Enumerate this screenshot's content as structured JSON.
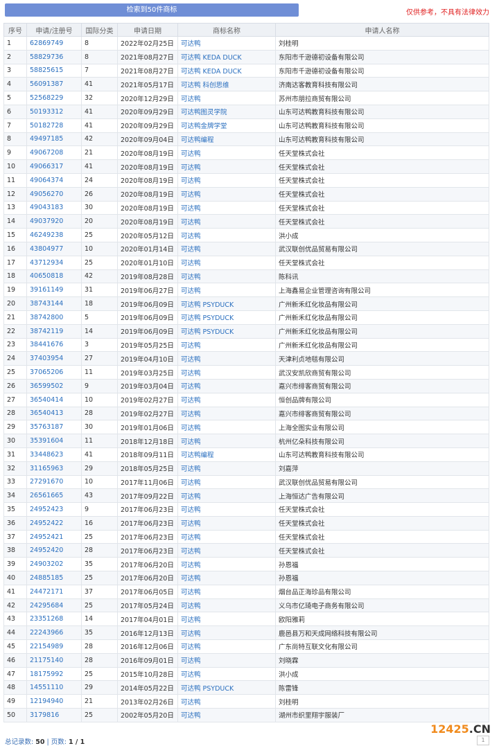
{
  "header": {
    "banner": "检索到50件商标",
    "disclaimer": "仅供参考，不具有法律效力"
  },
  "table": {
    "columns": [
      "序号",
      "申请/注册号",
      "国际分类",
      "申请日期",
      "商标名称",
      "申请人名称"
    ],
    "rows": [
      [
        "1",
        "62869749",
        "8",
        "2022年02月25日",
        "可达鸭",
        "刘桂明"
      ],
      [
        "2",
        "58829736",
        "8",
        "2021年08月27日",
        "可达鸭 KEDA DUCK",
        "东阳市千逊德初设备有限公司"
      ],
      [
        "3",
        "58825615",
        "7",
        "2021年08月27日",
        "可达鸭 KEDA DUCK",
        "东阳市千逊德初设备有限公司"
      ],
      [
        "4",
        "56091387",
        "41",
        "2021年05月17日",
        "可达鸭 科创思维",
        "济南达客教育科技有限公司"
      ],
      [
        "5",
        "52568229",
        "32",
        "2020年12月29日",
        "可达鸭",
        "苏州市朋拉商贸有限公司"
      ],
      [
        "6",
        "50193312",
        "41",
        "2020年09月29日",
        "可达鸭图灵学院",
        "山东可达鸭教育科技有限公司"
      ],
      [
        "7",
        "50182728",
        "41",
        "2020年09月29日",
        "可达鸭金牌学堂",
        "山东可达鸭教育科技有限公司"
      ],
      [
        "8",
        "49497185",
        "42",
        "2020年09月04日",
        "可达鸭编程",
        "山东可达鸭教育科技有限公司"
      ],
      [
        "9",
        "49067208",
        "21",
        "2020年08月19日",
        "可达鸭",
        "任天堂株式会社"
      ],
      [
        "10",
        "49066317",
        "41",
        "2020年08月19日",
        "可达鸭",
        "任天堂株式会社"
      ],
      [
        "11",
        "49064374",
        "24",
        "2020年08月19日",
        "可达鸭",
        "任天堂株式会社"
      ],
      [
        "12",
        "49056270",
        "26",
        "2020年08月19日",
        "可达鸭",
        "任天堂株式会社"
      ],
      [
        "13",
        "49043183",
        "30",
        "2020年08月19日",
        "可达鸭",
        "任天堂株式会社"
      ],
      [
        "14",
        "49037920",
        "20",
        "2020年08月19日",
        "可达鸭",
        "任天堂株式会社"
      ],
      [
        "15",
        "46249238",
        "25",
        "2020年05月12日",
        "可达鸭",
        "洪小成"
      ],
      [
        "16",
        "43804977",
        "10",
        "2020年01月14日",
        "可达鸭",
        "武汉联创优品贸易有限公司"
      ],
      [
        "17",
        "43712934",
        "25",
        "2020年01月10日",
        "可达鸭",
        "任天堂株式会社"
      ],
      [
        "18",
        "40650818",
        "42",
        "2019年08月28日",
        "可达鸭",
        "陈科讯"
      ],
      [
        "19",
        "39161149",
        "31",
        "2019年06月27日",
        "可达鸭",
        "上海鑫易企业管理咨询有限公司"
      ],
      [
        "20",
        "38743144",
        "18",
        "2019年06月09日",
        "可达鸭 PSYDUCK",
        "广州新禾红化妆品有限公司"
      ],
      [
        "21",
        "38742800",
        "5",
        "2019年06月09日",
        "可达鸭 PSYDUCK",
        "广州新禾红化妆品有限公司"
      ],
      [
        "22",
        "38742119",
        "14",
        "2019年06月09日",
        "可达鸭 PSYDUCK",
        "广州新禾红化妆品有限公司"
      ],
      [
        "23",
        "38441676",
        "3",
        "2019年05月25日",
        "可达鸭",
        "广州新禾红化妆品有限公司"
      ],
      [
        "24",
        "37403954",
        "27",
        "2019年04月10日",
        "可达鸭",
        "天津利贞地毯有限公司"
      ],
      [
        "25",
        "37065206",
        "11",
        "2019年03月25日",
        "可达鸭",
        "武汉安凯欣商贸有限公司"
      ],
      [
        "26",
        "36599502",
        "9",
        "2019年03月04日",
        "可达鸭",
        "嘉兴市绯客商贸有限公司"
      ],
      [
        "27",
        "36540414",
        "10",
        "2019年02月27日",
        "可达鸭",
        "恒创品牌有限公司"
      ],
      [
        "28",
        "36540413",
        "28",
        "2019年02月27日",
        "可达鸭",
        "嘉兴市绯客商贸有限公司"
      ],
      [
        "29",
        "35763187",
        "30",
        "2019年01月06日",
        "可达鸭",
        "上海全图实业有限公司"
      ],
      [
        "30",
        "35391604",
        "11",
        "2018年12月18日",
        "可达鸭",
        "杭州亿朵科技有限公司"
      ],
      [
        "31",
        "33448623",
        "41",
        "2018年09月11日",
        "可达鸭编程",
        "山东可达鸭教育科技有限公司"
      ],
      [
        "32",
        "31165963",
        "29",
        "2018年05月25日",
        "可达鸭",
        "刘嘉萍"
      ],
      [
        "33",
        "27291670",
        "10",
        "2017年11月06日",
        "可达鸭",
        "武汉联创优品贸易有限公司"
      ],
      [
        "34",
        "26561665",
        "43",
        "2017年09月22日",
        "可达鸭",
        "上海恒达广告有限公司"
      ],
      [
        "35",
        "24952423",
        "9",
        "2017年06月23日",
        "可达鸭",
        "任天堂株式会社"
      ],
      [
        "36",
        "24952422",
        "16",
        "2017年06月23日",
        "可达鸭",
        "任天堂株式会社"
      ],
      [
        "37",
        "24952421",
        "25",
        "2017年06月23日",
        "可达鸭",
        "任天堂株式会社"
      ],
      [
        "38",
        "24952420",
        "28",
        "2017年06月23日",
        "可达鸭",
        "任天堂株式会社"
      ],
      [
        "39",
        "24903202",
        "35",
        "2017年06月20日",
        "可达鸭",
        "孙恩福"
      ],
      [
        "40",
        "24885185",
        "25",
        "2017年06月20日",
        "可达鸭",
        "孙恩福"
      ],
      [
        "41",
        "24472171",
        "37",
        "2017年06月05日",
        "可达鸭",
        "烟台品正海珍品有限公司"
      ],
      [
        "42",
        "24295684",
        "25",
        "2017年05月24日",
        "可达鸭",
        "义乌市亿琦电子商务有限公司"
      ],
      [
        "43",
        "23351268",
        "14",
        "2017年04月01日",
        "可达鸭",
        "欧阳雅莉"
      ],
      [
        "44",
        "22243966",
        "35",
        "2016年12月13日",
        "可达鸭",
        "鹿邑县万和天成网络科技有限公司"
      ],
      [
        "45",
        "22154989",
        "28",
        "2016年12月06日",
        "可达鸭",
        "广东尚特互联文化有限公司"
      ],
      [
        "46",
        "21175140",
        "28",
        "2016年09月01日",
        "可达鸭",
        "刘晓霖"
      ],
      [
        "47",
        "18175992",
        "25",
        "2015年10月28日",
        "可达鸭",
        "洪小成"
      ],
      [
        "48",
        "14551110",
        "29",
        "2014年05月22日",
        "可达鸭 PSYDUCK",
        "陈雷锋"
      ],
      [
        "49",
        "12194940",
        "21",
        "2013年02月26日",
        "可达鸭",
        "刘桂明"
      ],
      [
        "50",
        "3179816",
        "25",
        "2002年05月20日",
        "可达鸭",
        "湖州市织里翔宇服装厂"
      ]
    ]
  },
  "footer": {
    "total_label": "总记录数:",
    "total_value": "50",
    "sep": "|",
    "pages_label": "页数:",
    "pages_value": "1 / 1",
    "page_button": "1"
  },
  "watermark": {
    "num": "12425",
    "dot": ".CN"
  }
}
